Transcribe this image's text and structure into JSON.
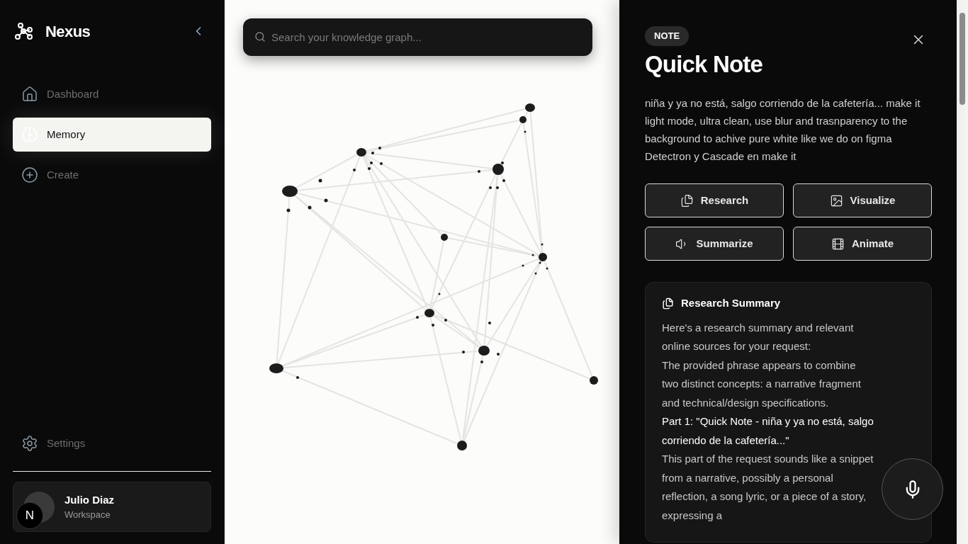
{
  "brand": {
    "name": "Nexus"
  },
  "nav": [
    {
      "label": "Dashboard",
      "selected": false
    },
    {
      "label": "Memory",
      "selected": true
    },
    {
      "label": "Create",
      "selected": false
    }
  ],
  "settings": {
    "label": "Settings",
    "selected": false
  },
  "user": {
    "name": "Julio Diaz",
    "subtitle": "Workspace",
    "badge": "N"
  },
  "search": {
    "placeholder": "Search your knowledge graph..."
  },
  "note": {
    "tag": "NOTE",
    "title": "Quick Note",
    "body": "niña y ya no está, salgo corriendo de la cafetería... make it light mode, ultra clean, use blur and trasnparency to the background to achive pure white like we do on figma Detectron y Cascade en make it"
  },
  "actions": [
    {
      "label": "Research"
    },
    {
      "label": "Visualize"
    },
    {
      "label": "Summarize"
    },
    {
      "label": "Animate"
    }
  ],
  "summary": {
    "title": "Research Summary",
    "paragraphs": [
      {
        "kind": "plain",
        "text": "Here's a research summary and relevant online sources for your request:"
      },
      {
        "kind": "plain",
        "text": "The provided phrase appears to combine two distinct concepts: a narrative fragment and technical/design specifications."
      },
      {
        "kind": "emphasis",
        "text": "Part 1: \"Quick Note - niña y ya no está, salgo corriendo de la cafetería...\""
      },
      {
        "kind": "plain",
        "text": "This part of the request sounds like a snippet from a narrative, possibly a personal reflection, a song lyric, or a piece of a story, expressing a"
      }
    ]
  }
}
